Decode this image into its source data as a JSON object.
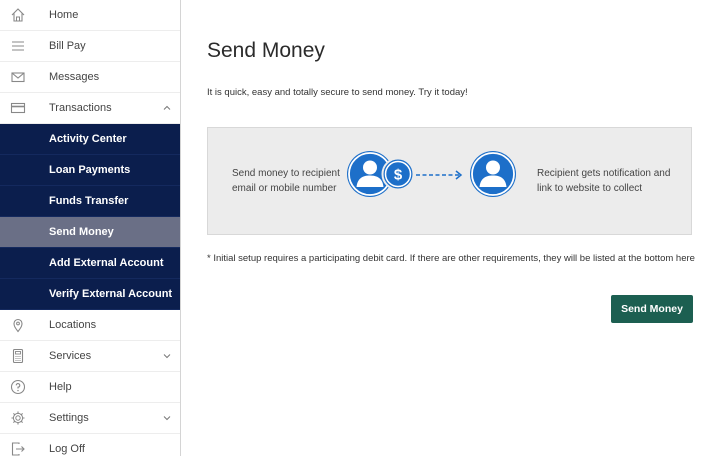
{
  "sidebar": {
    "top_items": [
      {
        "label": "Home",
        "icon": "home-icon"
      },
      {
        "label": "Bill Pay",
        "icon": "menu-lines-icon"
      },
      {
        "label": "Messages",
        "icon": "envelope-icon"
      },
      {
        "label": "Transactions",
        "icon": "card-icon",
        "expanded": true
      }
    ],
    "sub_items": [
      {
        "label": "Activity Center"
      },
      {
        "label": "Loan Payments"
      },
      {
        "label": "Funds Transfer"
      },
      {
        "label": "Send Money",
        "active": true
      },
      {
        "label": "Add External Account"
      },
      {
        "label": "Verify External Account"
      }
    ],
    "bottom_items": [
      {
        "label": "Locations",
        "icon": "location-pin-icon"
      },
      {
        "label": "Services",
        "icon": "calculator-icon",
        "has_chevron": true
      },
      {
        "label": "Help",
        "icon": "help-circle-icon"
      },
      {
        "label": "Settings",
        "icon": "gear-icon",
        "has_chevron": true
      },
      {
        "label": "Log Off",
        "icon": "logout-icon"
      }
    ]
  },
  "main": {
    "title": "Send Money",
    "intro": "It is quick, easy and totally secure to send money. Try it today!",
    "diagram": {
      "sender_text": "Send money to recipient email or mobile number",
      "recipient_text": "Recipient gets notification and link to website to collect",
      "currency_symbol": "$"
    },
    "footnote": "* Initial setup requires a participating debit card. If there are other requirements, they will be listed at the bottom here",
    "send_button_label": "Send Money"
  },
  "colors": {
    "sidebar_submenu_bg": "#0b1e4d",
    "sidebar_active_bg": "#6a6f86",
    "icon_blue": "#1d6fc9",
    "button_green": "#1c5f51"
  }
}
